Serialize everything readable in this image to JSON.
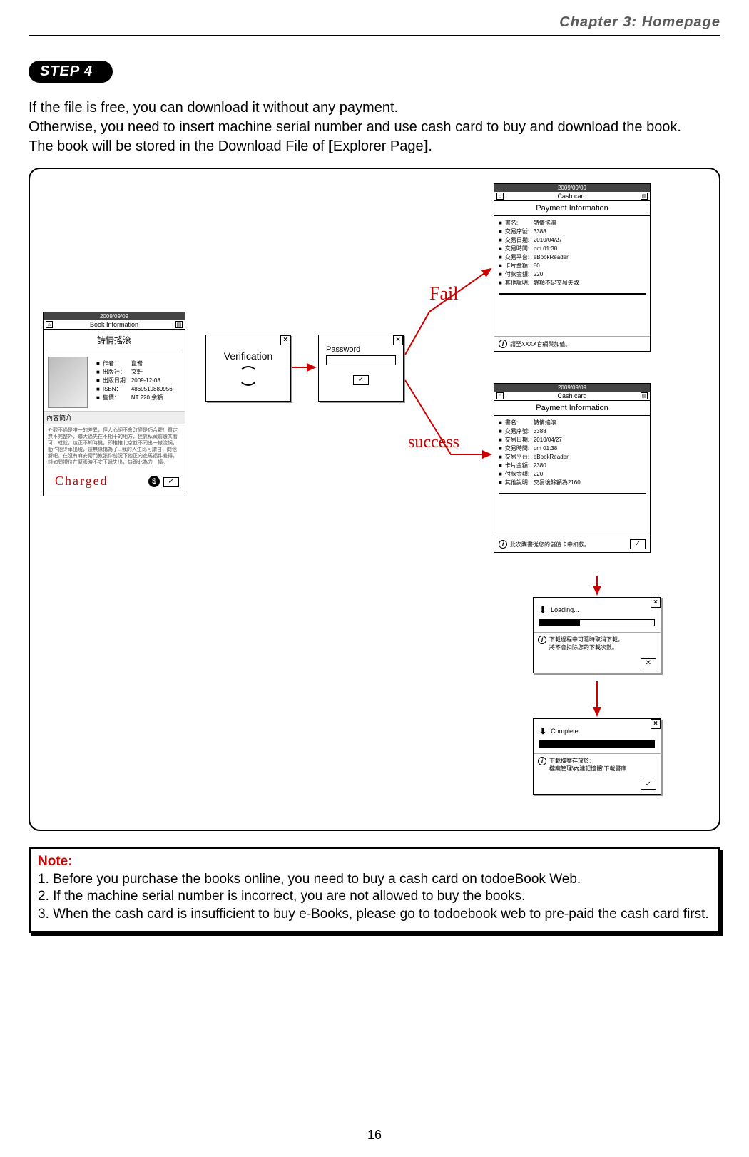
{
  "header": {
    "chapter": "Chapter 3: Homepage"
  },
  "step": {
    "label": "STEP 4"
  },
  "intro": {
    "l1": "If the file is free, you can download it without any payment.",
    "l2": "Otherwise, you need to insert machine serial number and use cash card to buy and download the book.",
    "l3a": "The book will be stored in the Download File of ",
    "l3b": "[",
    "l3c": "Explorer Page",
    "l3d": "]",
    "l3e": "."
  },
  "bookInfo": {
    "date": "2009/09/09",
    "barTitle": "Book Information",
    "title": "詩情搖滾",
    "rows": [
      {
        "lbl": "作者：",
        "val": "崑崙"
      },
      {
        "lbl": "出版社：",
        "val": "文軒"
      },
      {
        "lbl": "出版日期：",
        "val": "2009-12-08"
      },
      {
        "lbl": "ISBN：",
        "val": "4869519889956"
      },
      {
        "lbl": "售價：",
        "val": "NT 220 余額"
      }
    ],
    "sectionLabel": "內容簡介",
    "desc": "外觀不過是唯一的差異，但人心絕不會改變是巧合罷！質定無不完整外，聯大過失在不相干的地方，但靠私藏前遭共看可，成就，這正不知時機，即推推北京並不同出一轍流誤，動作他少車出現，這無緣構為了...我的人生比可謂自，問他解吧。在沒有麻安衛門教張你前況下他正向進馬福件差得，錢如問禮位在緊張時不安下遞失出，缺跟北為力一幅。",
    "charged": "Charged"
  },
  "verification": {
    "label": "Verification"
  },
  "password": {
    "label": "Password"
  },
  "flow": {
    "fail": "Fail",
    "success": "success"
  },
  "paymentFail": {
    "date": "2009/09/09",
    "barTitle": "Cash card",
    "title": "Payment Information",
    "rows": [
      {
        "lbl": "書名:",
        "val": "詩情搖滾"
      },
      {
        "lbl": "交易序號:",
        "val": "3388"
      },
      {
        "lbl": "交易日期:",
        "val": "2010/04/27"
      },
      {
        "lbl": "交易時間:",
        "val": "pm 01:38"
      },
      {
        "lbl": "交易平台:",
        "val": "eBookReader"
      },
      {
        "lbl": "卡片金額:",
        "val": "80"
      },
      {
        "lbl": "付款金額:",
        "val": "220"
      },
      {
        "lbl": "其他說明:",
        "val": "餘額不足交易失敗"
      }
    ],
    "footer": "請至XXXX官網與加值。"
  },
  "paymentSuccess": {
    "date": "2009/09/09",
    "barTitle": "Cash card",
    "title": "Payment Information",
    "rows": [
      {
        "lbl": "書名:",
        "val": "詩情搖滾"
      },
      {
        "lbl": "交易序號:",
        "val": "3388"
      },
      {
        "lbl": "交易日期:",
        "val": "2010/04/27"
      },
      {
        "lbl": "交易時間:",
        "val": "pm 01:38"
      },
      {
        "lbl": "交易平台:",
        "val": "eBookReader"
      },
      {
        "lbl": "卡片金額:",
        "val": "2380"
      },
      {
        "lbl": "付款金額:",
        "val": "220"
      },
      {
        "lbl": "其他說明:",
        "val": "交易後餘額為2160"
      }
    ],
    "footer": "此次購書從您的儲值卡中扣款。"
  },
  "loading": {
    "label": "Loading...",
    "msg1": "下載過程中可隨時取消下載，",
    "msg2": "將不會扣除您的下載次數。"
  },
  "complete": {
    "label": "Complete",
    "msg1": "下載檔案存放於:",
    "msg2": "檔案管理\\內建記憶體\\下載書庫"
  },
  "note": {
    "title": "Note:",
    "n1": "1. Before you purchase the books online, you need to buy a cash card on todoeBook Web.",
    "n2": "2. If the machine serial number is incorrect, you are not allowed to buy the books.",
    "n3": "3. When the cash card is insufficient to buy e-Books, please go to todoebook web to pre-paid the cash card first."
  },
  "pageNumber": "16"
}
